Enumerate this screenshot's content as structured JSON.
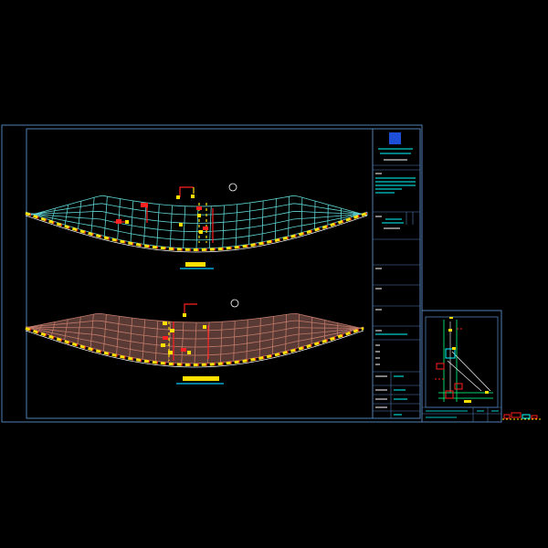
{
  "colors": {
    "background": "#000000",
    "frame": "#4f7fb5",
    "mesh_top": "#5fd3d3",
    "mesh_bottom": "#c07a6a",
    "mesh_bottom_fill": "#5a3a34",
    "accent_yellow": "#ffe000",
    "accent_red": "#ff2020",
    "caption_bar": "#00c8ff",
    "logo_blue": "#1d4fd8",
    "detail_green": "#00d06a",
    "detail_cyan": "#00ffff"
  },
  "icons": {
    "company_logo": "square-logo-icon",
    "section_marker": "circle-marker-icon"
  },
  "drawing": {
    "view_count": 2,
    "detail_sheet_count": 1
  }
}
